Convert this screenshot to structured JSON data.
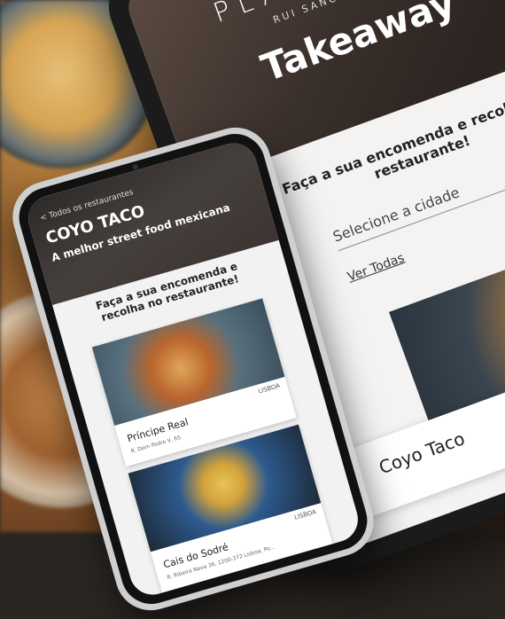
{
  "tablet": {
    "brand": "PLATEFORMA",
    "brand_sub": "RUI SANCHES",
    "heading": "Takeaway",
    "headline": "Faça a sua encomenda e recolha no restaurante!",
    "city_select_placeholder": "Selecione a cidade",
    "see_all_link": "Ver Todas",
    "restaurant_card_name": "Coyo Taco"
  },
  "phone": {
    "back_link": "< Todos os restaurantes",
    "restaurant_title": "COYO TACO",
    "tagline": "A melhor street food mexicana",
    "intro": "Faça a sua encomenda e recolha no restaurante!",
    "locations": [
      {
        "name": "Príncipe Real",
        "address": "R. Dom Pedro V, 65",
        "city": "LISBOA"
      },
      {
        "name": "Cais do Sodré",
        "address": "R. Ribeira Nova 36, 1200-372 Lisboa, Po...",
        "city": "LISBOA"
      }
    ]
  }
}
